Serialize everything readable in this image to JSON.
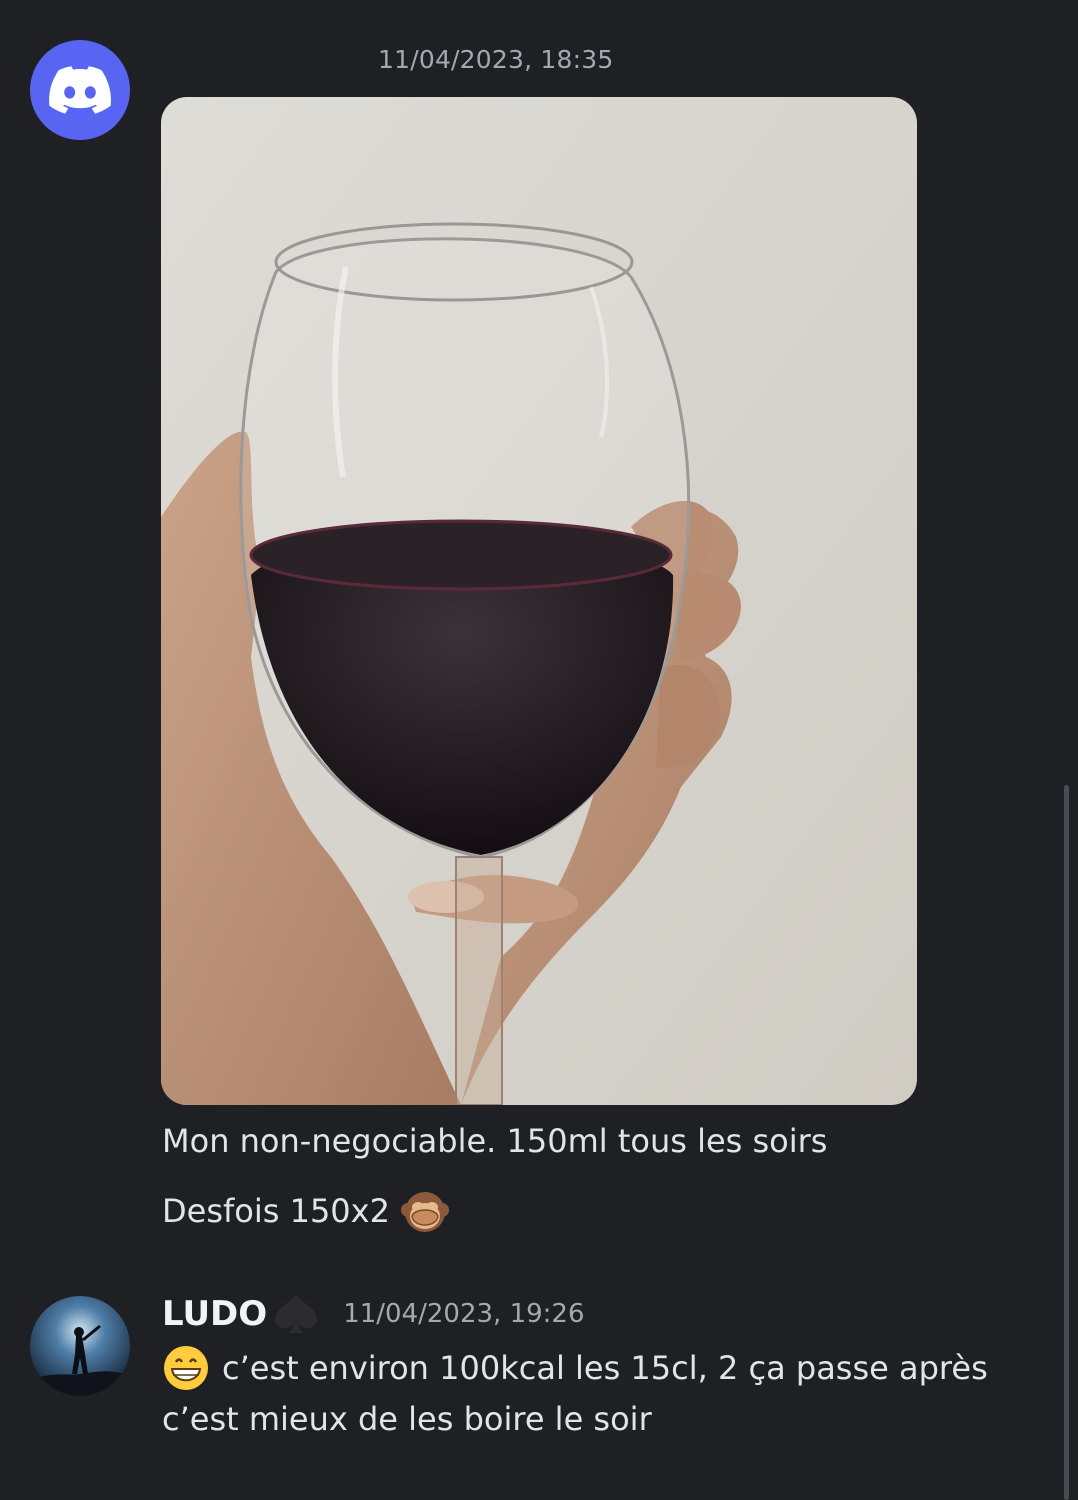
{
  "message1": {
    "timestamp": "11/04/2023, 18:35",
    "caption_line1": "Mon non-negociable. 150ml tous les soirs",
    "caption_line2": "Desfois 150x2",
    "emoji": "see-no-evil-monkey"
  },
  "message2": {
    "author": "LUDO",
    "author_badge": "spade-icon",
    "timestamp": "11/04/2023, 19:26",
    "emoji": "grinning-face",
    "line1": "c’est environ 100kcal les 15cl, 2 ça passe après",
    "line2": "c’est mieux de les boire le soir"
  },
  "colors": {
    "background": "#1f2024",
    "discord_blurple": "#5865f2",
    "text": "#e3e4e7",
    "muted": "#a6a8ad"
  }
}
